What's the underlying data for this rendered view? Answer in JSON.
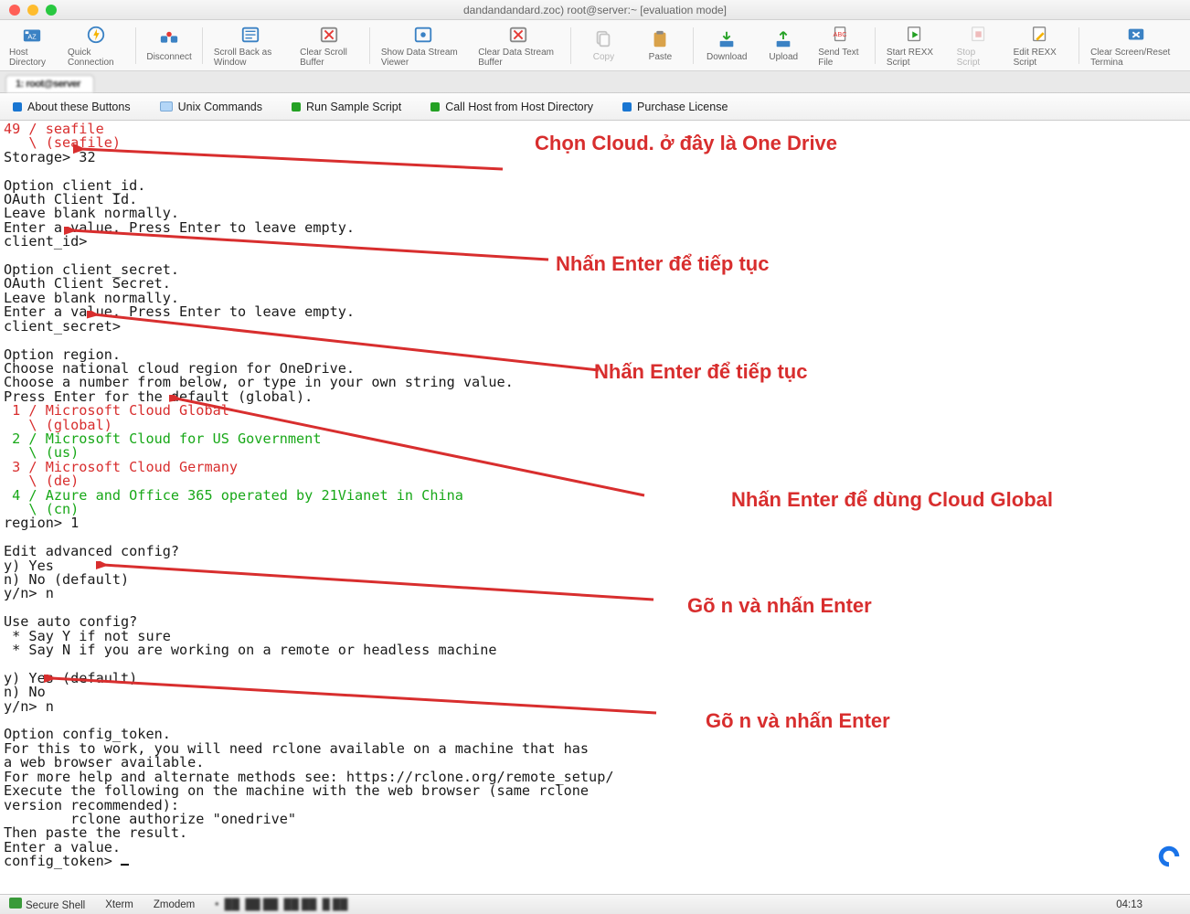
{
  "titlebar": {
    "title": "dandandandard.zoc) root@server:~ [evaluation mode]"
  },
  "toolbar": [
    {
      "name": "host-directory",
      "label": "Host Directory",
      "icon": "folder-az"
    },
    {
      "name": "quick-connection",
      "label": "Quick Connection",
      "icon": "bolt"
    },
    {
      "name": "disconnect",
      "label": "Disconnect",
      "icon": "disconnect"
    },
    {
      "name": "scroll-back-window",
      "label": "Scroll Back as Window",
      "icon": "scroll"
    },
    {
      "name": "clear-scroll-buffer",
      "label": "Clear Scroll Buffer",
      "icon": "clear"
    },
    {
      "name": "show-data-stream",
      "label": "Show Data Stream Viewer",
      "icon": "eye"
    },
    {
      "name": "clear-data-stream",
      "label": "Clear Data Stream Buffer",
      "icon": "clear2"
    },
    {
      "name": "copy",
      "label": "Copy",
      "icon": "copy",
      "disabled": true
    },
    {
      "name": "paste",
      "label": "Paste",
      "icon": "paste"
    },
    {
      "name": "download",
      "label": "Download",
      "icon": "download"
    },
    {
      "name": "upload",
      "label": "Upload",
      "icon": "upload"
    },
    {
      "name": "send-text-file",
      "label": "Send Text File",
      "icon": "send"
    },
    {
      "name": "start-rexx",
      "label": "Start REXX Script",
      "icon": "play"
    },
    {
      "name": "stop-script",
      "label": "Stop Script",
      "icon": "stop",
      "disabled": true
    },
    {
      "name": "edit-rexx",
      "label": "Edit REXX Script",
      "icon": "edit"
    },
    {
      "name": "clear-screen",
      "label": "Clear Screen/Reset Termina",
      "icon": "reset"
    }
  ],
  "tab": {
    "label": "1: root@server"
  },
  "btnbar": [
    {
      "name": "about-buttons",
      "label": "About these Buttons",
      "mark": "blue"
    },
    {
      "name": "unix-commands",
      "label": "Unix Commands",
      "mark": "folder"
    },
    {
      "name": "run-sample",
      "label": "Run Sample Script",
      "mark": "grn"
    },
    {
      "name": "call-host",
      "label": "Call Host from Host Directory",
      "mark": "grn"
    },
    {
      "name": "purchase",
      "label": "Purchase License",
      "mark": "blue"
    }
  ],
  "terminal": {
    "l1": "49 / seafile",
    "l2": "   \\ (seafile)",
    "l3a": "Storage> ",
    "l3b": "32",
    "l4": "Option client_id.",
    "l5": "OAuth Client Id.",
    "l6": "Leave blank normally.",
    "l7": "Enter a value. Press Enter to leave empty.",
    "l8": "client_id>",
    "l9": "Option client_secret.",
    "l10": "OAuth Client Secret.",
    "l11": "Leave blank normally.",
    "l12": "Enter a value. Press Enter to leave empty.",
    "l13": "client_secret>",
    "l14": "Option region.",
    "l15": "Choose national cloud region for OneDrive.",
    "l16": "Choose a number from below, or type in your own string value.",
    "l17": "Press Enter for the default (global).",
    "l18": " 1 / Microsoft Cloud Global",
    "l19": "   \\ (global)",
    "l20": " 2 / Microsoft Cloud for US Government",
    "l21": "   \\ (us)",
    "l22": " 3 / Microsoft Cloud Germany",
    "l23": "   \\ (de)",
    "l24": " 4 / Azure and Office 365 operated by 21Vianet in China",
    "l25": "   \\ (cn)",
    "l26a": "region> ",
    "l26b": "1",
    "l27": "Edit advanced config?",
    "l28": "y) Yes",
    "l29": "n) No (default)",
    "l30a": "y/n> ",
    "l30b": "n",
    "l31": "Use auto config?",
    "l32": " * Say Y if not sure",
    "l33": " * Say N if you are working on a remote or headless machine",
    "l34": "y) Yes (default)",
    "l35": "n) No",
    "l36a": "y/n> ",
    "l36b": "n",
    "l37": "Option config_token.",
    "l38": "For this to work, you will need rclone available on a machine that has",
    "l39": "a web browser available.",
    "l40": "For more help and alternate methods see: https://rclone.org/remote_setup/",
    "l41": "Execute the following on the machine with the web browser (same rclone",
    "l42": "version recommended):",
    "l43": "\trclone authorize \"onedrive\"",
    "l44": "Then paste the result.",
    "l45": "Enter a value.",
    "l46": "config_token> "
  },
  "annotations": {
    "a1": "Chọn Cloud. ở đây là One Drive",
    "a2": "Nhấn Enter để tiếp tục",
    "a3": "Nhấn Enter để tiếp tục",
    "a4": "Nhấn Enter để dùng Cloud Global",
    "a5": "Gõ n và nhấn Enter",
    "a6": "Gõ n và nhấn Enter"
  },
  "status": {
    "s1": "Secure Shell",
    "s2": "Xterm",
    "s3": "Zmodem",
    "time": "04:13"
  }
}
